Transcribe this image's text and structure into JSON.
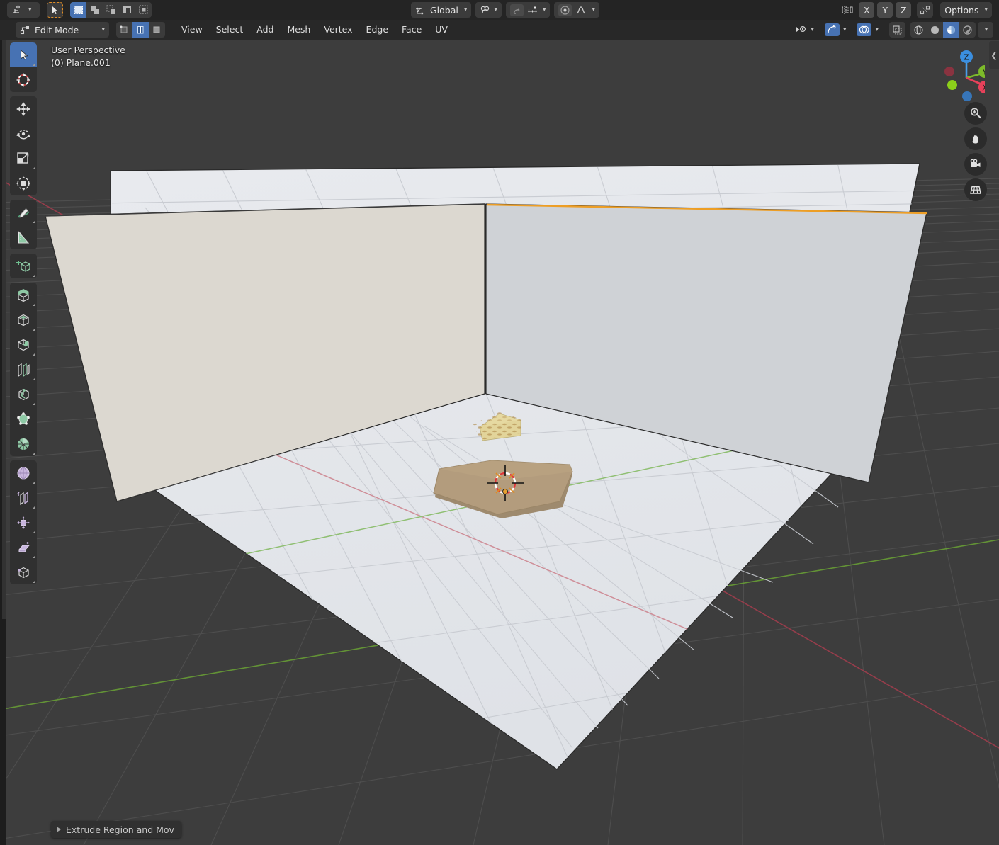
{
  "app": {
    "name": "Blender",
    "editor": "3D Viewport"
  },
  "topbar": {
    "editor_type_icon": "editor-type-icon",
    "cursor_tool_icon": "cursor-select-icon",
    "select_modes": [
      {
        "name": "select-box",
        "active": true
      },
      {
        "name": "select-extend",
        "active": false
      },
      {
        "name": "select-subtract",
        "active": false
      },
      {
        "name": "select-invert",
        "active": false
      },
      {
        "name": "select-intersect",
        "active": false
      }
    ],
    "transform_orientation": {
      "label": "Global",
      "icon": "orientation-icon"
    },
    "snap": {
      "icon": "magnet-icon",
      "enabled": false
    },
    "snap_to": {
      "icon": "snap-increment-icon"
    },
    "proportional_edit": {
      "icon": "proportional-icon",
      "enabled": false
    },
    "falloff": {
      "icon": "falloff-curve-icon"
    },
    "mirror_label": "Mirror",
    "mirror_axes": [
      "X",
      "Y",
      "Z"
    ],
    "mirror_icon": "mirror-icon",
    "topology_mirror_icon": "topology-mirror-icon",
    "options_label": "Options"
  },
  "header": {
    "mode": {
      "label": "Edit Mode",
      "icon": "edit-mode-icon"
    },
    "mesh_select_modes": [
      {
        "name": "vertex-select-mode",
        "active": false
      },
      {
        "name": "edge-select-mode",
        "active": true
      },
      {
        "name": "face-select-mode",
        "active": false
      }
    ],
    "menus": [
      "View",
      "Select",
      "Add",
      "Mesh",
      "Vertex",
      "Edge",
      "Face",
      "UV"
    ],
    "right_controls": {
      "visibility_icon": "object-visibility-icon",
      "gizmo_icon": "gizmo-icon",
      "gizmo_enabled": true,
      "overlays_icon": "overlays-icon",
      "overlays_enabled": true,
      "xray_icon": "xray-toggle-icon",
      "shading_modes": [
        {
          "name": "wireframe-shading",
          "active": false
        },
        {
          "name": "solid-shading",
          "active": false
        },
        {
          "name": "material-preview-shading",
          "active": true
        },
        {
          "name": "rendered-shading",
          "active": false
        }
      ]
    }
  },
  "toolbar": {
    "groups": [
      [
        {
          "name": "tweak-tool",
          "active": true,
          "icon": "cursor-arrow-icon"
        },
        {
          "name": "cursor-tool",
          "active": false,
          "icon": "3d-cursor-icon"
        }
      ],
      [
        {
          "name": "move-tool",
          "active": false,
          "icon": "move-arrows-icon"
        },
        {
          "name": "rotate-tool",
          "active": false,
          "icon": "rotate-icon"
        },
        {
          "name": "scale-tool",
          "active": false,
          "icon": "scale-icon"
        },
        {
          "name": "transform-tool",
          "active": false,
          "icon": "transform-icon"
        }
      ],
      [
        {
          "name": "annotate-tool",
          "active": false,
          "icon": "pencil-icon"
        },
        {
          "name": "measure-tool",
          "active": false,
          "icon": "ruler-icon"
        }
      ],
      [
        {
          "name": "add-cube-tool",
          "active": false,
          "icon": "add-cube-icon"
        }
      ],
      [
        {
          "name": "extrude-region-tool",
          "active": false,
          "icon": "extrude-region-icon"
        },
        {
          "name": "inset-faces-tool",
          "active": false,
          "icon": "inset-faces-icon"
        },
        {
          "name": "bevel-tool",
          "active": false,
          "icon": "bevel-icon"
        },
        {
          "name": "loop-cut-tool",
          "active": false,
          "icon": "loop-cut-icon"
        },
        {
          "name": "knife-tool",
          "active": false,
          "icon": "knife-icon"
        },
        {
          "name": "poly-build-tool",
          "active": false,
          "icon": "poly-build-icon"
        },
        {
          "name": "spin-tool",
          "active": false,
          "icon": "spin-icon"
        }
      ],
      [
        {
          "name": "smooth-tool",
          "active": false,
          "icon": "smooth-icon"
        },
        {
          "name": "edge-slide-tool",
          "active": false,
          "icon": "edge-slide-icon"
        },
        {
          "name": "shrink-fatten-tool",
          "active": false,
          "icon": "shrink-fatten-icon"
        },
        {
          "name": "shear-tool",
          "active": false,
          "icon": "shear-icon"
        },
        {
          "name": "rip-region-tool",
          "active": false,
          "icon": "rip-region-icon"
        }
      ]
    ]
  },
  "viewport": {
    "perspective_label": "User Perspective",
    "object_label": "(0) Plane.001",
    "nav_gizmo": {
      "axes": [
        {
          "label": "Z",
          "color": "#3b8fe0"
        },
        {
          "label": "Y",
          "color": "#7dbb2a"
        },
        {
          "label": "X",
          "color": "#e8415a"
        }
      ]
    },
    "nav_buttons": [
      {
        "name": "zoom-view-button",
        "icon": "magnifier-plus-icon"
      },
      {
        "name": "pan-view-button",
        "icon": "hand-icon"
      },
      {
        "name": "camera-view-button",
        "icon": "camera-icon"
      },
      {
        "name": "toggle-perspective-button",
        "icon": "grid-perspective-icon"
      }
    ],
    "sidebar_toggle_icon": "chevron-left-icon",
    "scene": {
      "objects": [
        {
          "name": "floor-plane",
          "color": "#e3e6ea"
        },
        {
          "name": "wall-left",
          "color": "#d9d5cd"
        },
        {
          "name": "wall-right",
          "color": "#cfd2d6"
        },
        {
          "name": "cutting-board",
          "color": "#b39c7d"
        },
        {
          "name": "cheese-wedge",
          "color": "#e3d396"
        }
      ],
      "selected_edge_color": "#ed9e25",
      "cursor_name": "3d-cursor",
      "axis_x_color": "#b9455a",
      "axis_y_color": "#5c9e2d",
      "grid_color": "#4a4a4a",
      "background_color": "#3d3d3d"
    }
  },
  "operator_panel": {
    "label": "Extrude Region and Mov",
    "expand_icon": "triangle-right-icon"
  }
}
